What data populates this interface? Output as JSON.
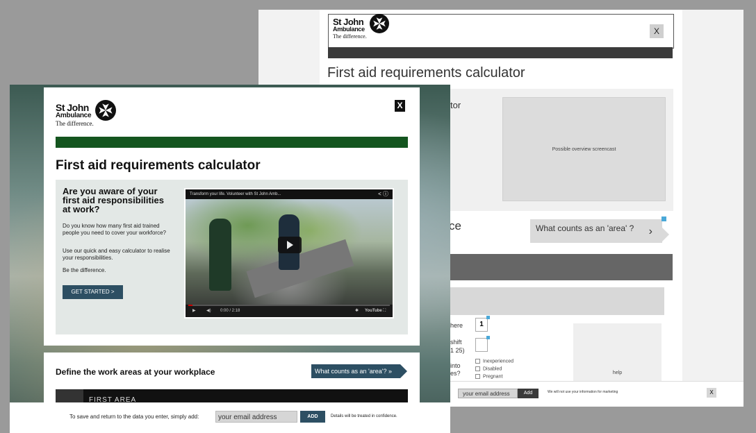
{
  "brand": {
    "line1": "St John",
    "line2": "Ambulance",
    "tagline": "The difference."
  },
  "close_label": "X",
  "wireframe": {
    "title": "First aid requirements calculator",
    "fragment_tor": "tor",
    "screencast_label": "Possible overview screencast",
    "fragment_ce": "ce",
    "area_label": "What counts as an 'area' ?",
    "chevron": "›",
    "frag_here": "here",
    "frag_shift": "shift",
    "frag_25": "1 25)",
    "frag_into": "into",
    "frag_es": "es?",
    "field_value": "1",
    "checkboxes": [
      "Inexperienced",
      "Disabled",
      "Pregnant"
    ],
    "help_label": "help",
    "footer": {
      "email_placeholder": "your email address",
      "add_label": "Add",
      "notice": "We will not use your information for marketing",
      "close_label": "X"
    }
  },
  "main": {
    "title": "First aid requirements calculator",
    "intro_heading": "Are you aware of your first aid responsibilities at work?",
    "para1": "Do you know how many first aid trained people you need to cover your workforce?",
    "para2": "Use our quick and easy calculator to realise your responsibilities.",
    "para3": "Be the difference.",
    "cta_label": "GET STARTED >",
    "video": {
      "title": "Transform your life. Volunteer with St John Amb...",
      "time": "0:00 / 2:18",
      "share_icon": "share-icon",
      "info_icon": "info-icon"
    },
    "define_heading": "Define the work areas at your workplace",
    "area_help_label": "What counts as an 'area'? »",
    "first_area_label": "FIRST AREA",
    "footer": {
      "save_text": "To save and return to the data you enter, simply add:",
      "email_placeholder": "your email address",
      "add_label": "ADD",
      "confidential_text": "Details will be treated in confidence."
    }
  },
  "colors": {
    "green_bar": "#14551f",
    "accent_blue": "#2d4f63",
    "info_blue": "#4aa8d8"
  }
}
